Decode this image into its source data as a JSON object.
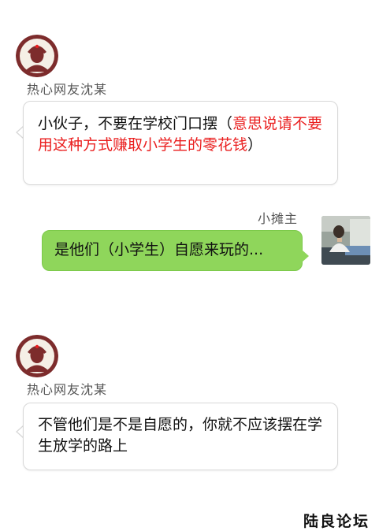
{
  "messages": [
    {
      "sender": "热心网友沈某",
      "segments": [
        {
          "text": "小伙子，不要在学校门口摆（",
          "color": "#111111"
        },
        {
          "text": "意思说请不要用这种方式赚取小学生的零花钱",
          "color": "#ea1e1e"
        },
        {
          "text": "）",
          "color": "#111111"
        }
      ]
    },
    {
      "sender": "小摊主",
      "text": "是他们（小学生）自愿来玩的..."
    },
    {
      "sender": "热心网友沈某",
      "text": "不管他们是不是自愿的，你就不应该摆在学生放学的路上"
    }
  ],
  "watermark": "陆良论坛",
  "colors": {
    "bubble_green": "#8fd65b",
    "highlight_red": "#ea1e1e",
    "avatar_maroon": "#7d2c2c"
  }
}
